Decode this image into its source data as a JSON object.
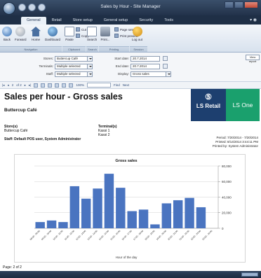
{
  "window": {
    "title": "Sales by Hour - Site Manager"
  },
  "ribbon_tabs": [
    "General",
    "Retail",
    "Store setup",
    "General setup",
    "Security",
    "Tools"
  ],
  "ribbon": {
    "buttons": {
      "back": "Back",
      "forward": "Forward",
      "home": "Home",
      "dashboard": "Dashboard",
      "paste": "Paste",
      "cut": "Cut",
      "copy": "Copy",
      "search": "Search",
      "print": "Print...",
      "page_setup": "Page setup",
      "print_preview": "Print preview",
      "log_out": "Log out"
    },
    "groups": [
      "Navigation",
      "Clipboard",
      "Search",
      "Printing",
      "Session"
    ]
  },
  "filters": {
    "stores_label": "Stores:",
    "stores_value": "Buttercup Café",
    "terminals_label": "Terminals:",
    "terminals_value": "Multiple selected",
    "staff_label": "Staff:",
    "staff_value": "Multiple selected",
    "start_date_label": "Start date:",
    "start_date_value": "20.7.2014",
    "end_date_label": "End date:",
    "end_date_value": "20.7.2014",
    "display_label": "Display:",
    "display_value": "Gross sales",
    "view_report_button": "View report"
  },
  "report_toolbar": {
    "page_info": "of 2",
    "page_current": "2",
    "zoom": "100%",
    "find": "Find",
    "next": "Next"
  },
  "report": {
    "title": "Sales per hour - Gross sales",
    "company": "Buttercup Café",
    "stores_heading": "Store(s)",
    "stores_value": "Buttercup Café",
    "terminals_heading": "Terminal(s)",
    "terminals_values": [
      "Kassi 1",
      "Kassi 2"
    ],
    "staff_line": "Staff: Default POS user, System Administrator",
    "period": "Period: 7/20/2014 - 7/20/2014",
    "printed": "Printed: 8/14/2014 3:44:11 PM",
    "printed_by": "Printed by: System Administrator",
    "logo_brand": "LS Retail",
    "logo_product": "LS One",
    "page_footer": "Page: 2 of 2"
  },
  "colors": {
    "bar": "#4a74c0",
    "logo_blue": "#1d3f6f",
    "logo_green": "#1aa06d",
    "ribbon_dark": "#22324a"
  },
  "chart_data": {
    "type": "bar",
    "title": "Gross sales",
    "xlabel": "Hour of the day",
    "ylabel": "",
    "categories": [
      "08:00 - 09:00",
      "09:00 - 10:00",
      "10:00 - 11:00",
      "11:00 - 12:00",
      "12:00 - 13:00",
      "13:00 - 14:00",
      "14:00 - 15:00",
      "15:00 - 16:00",
      "16:00 - 17:00",
      "17:00 - 18:00",
      "18:00 - 19:00",
      "19:00 - 20:00",
      "20:00 - 21:00",
      "21:00 - 22:00",
      "22:00 - 23:00",
      "23:00 - 24:00"
    ],
    "values": [
      8000,
      10000,
      8000,
      54000,
      38000,
      51000,
      70000,
      52000,
      22000,
      24000,
      5000,
      32000,
      36000,
      39000,
      27000,
      0
    ],
    "y_ticks": [
      "0",
      "20,000",
      "40,000",
      "60,000",
      "80,000"
    ],
    "ylim": [
      0,
      80000
    ],
    "grid": true
  }
}
